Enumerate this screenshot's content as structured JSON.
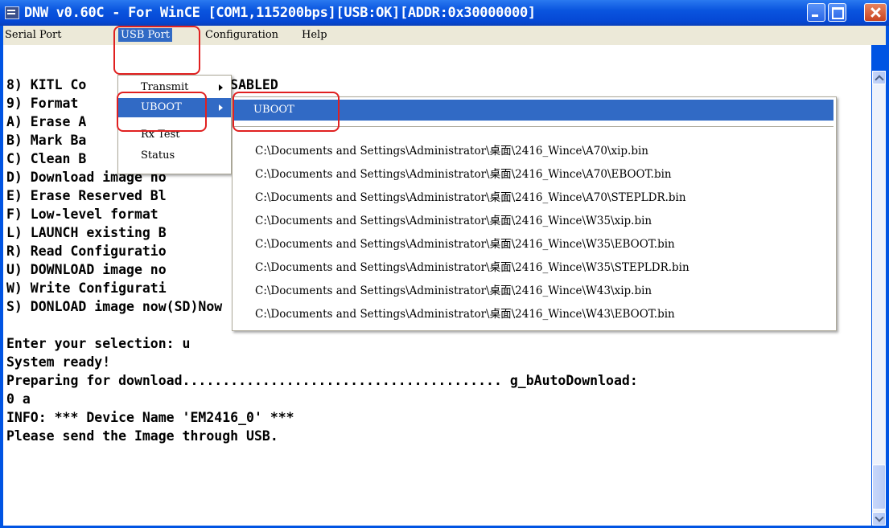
{
  "window": {
    "title": "DNW v0.60C - For WinCE    [COM1,115200bps][USB:OK][ADDR:0x30000000]"
  },
  "menubar": {
    "items": [
      "Serial Port",
      "USB Port",
      "Configuration",
      "Help"
    ]
  },
  "console": {
    "lines": [
      "8) KITL Co              : DISABLED",
      "9) Format",
      "A) Erase A",
      "B) Mark Ba",
      "C) Clean B",
      "D) Download image no",
      "E) Erase Reserved Bl",
      "F) Low-level format",
      "L) LAUNCH existing B",
      "R) Read Configuratio",
      "U) DOWNLOAD image no",
      "W) Write Configurati",
      "S) DONLOAD image now(SD)Now",
      "",
      "Enter your selection: u",
      "System ready!",
      "Preparing for download........................................ g_bAutoDownload:",
      "0 a",
      "INFO: *** Device Name 'EM2416_0' ***",
      "Please send the Image through USB."
    ]
  },
  "usb_menu": {
    "items": [
      "Transmit",
      "UBOOT",
      "Rx Test",
      "Status"
    ]
  },
  "uboot_menu": {
    "top_item": "UBOOT",
    "recent_files": [
      "C:\\Documents and Settings\\Administrator\\桌面\\2416_Wince\\A70\\xip.bin",
      "C:\\Documents and Settings\\Administrator\\桌面\\2416_Wince\\A70\\EBOOT.bin",
      "C:\\Documents and Settings\\Administrator\\桌面\\2416_Wince\\A70\\STEPLDR.bin",
      "C:\\Documents and Settings\\Administrator\\桌面\\2416_Wince\\W35\\xip.bin",
      "C:\\Documents and Settings\\Administrator\\桌面\\2416_Wince\\W35\\EBOOT.bin",
      "C:\\Documents and Settings\\Administrator\\桌面\\2416_Wince\\W35\\STEPLDR.bin",
      "C:\\Documents and Settings\\Administrator\\桌面\\2416_Wince\\W43\\xip.bin",
      "C:\\Documents and Settings\\Administrator\\桌面\\2416_Wince\\W43\\EBOOT.bin"
    ]
  },
  "colors": {
    "titlebar": "#0a55df",
    "menu_highlight": "#316ac5",
    "annotation": "#e02020"
  }
}
